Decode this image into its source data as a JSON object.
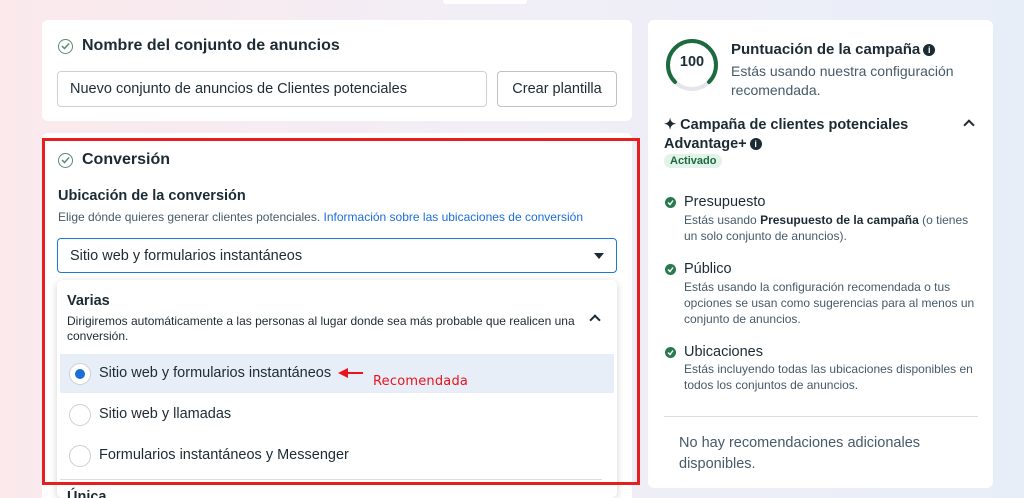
{
  "ad_set_name": {
    "heading": "Nombre del conjunto de anuncios",
    "value": "Nuevo conjunto de anuncios de Clientes potenciales",
    "template_button": "Crear plantilla"
  },
  "conversion": {
    "heading": "Conversión",
    "location_label": "Ubicación de la conversión",
    "helper": "Elige dónde quieres generar clientes potenciales. ",
    "helper_link": "Información sobre las ubicaciones de conversión",
    "selected": "Sitio web y formularios instantáneos",
    "dropdown": {
      "group_title": "Varias",
      "group_desc": "Dirigiremos automáticamente a las personas al lugar donde sea más probable que realicen una conversión.",
      "options": [
        {
          "label": "Sitio web y formularios instantáneos",
          "selected": true
        },
        {
          "label": "Sitio web y llamadas",
          "selected": false
        },
        {
          "label": "Formularios instantáneos y Messenger",
          "selected": false
        }
      ],
      "next_group_title": "Única"
    },
    "annotation": "Recomendada",
    "annotation_color": "#e8141c"
  },
  "sidebar": {
    "score": "100",
    "score_title": "Puntuación de la campaña",
    "score_desc": "Estás usando nuestra configuración recomendada.",
    "advantage_title": "✦ Campaña de clientes potenciales Advantage+",
    "badge": "Activado",
    "items": [
      {
        "title": "Presupuesto",
        "desc_pre": "Estás usando ",
        "desc_bold": "Presupuesto de la campaña",
        "desc_post": " (o tienes un solo conjunto de anuncios)."
      },
      {
        "title": "Público",
        "desc": "Estás usando la configuración recomendada o tus opciones se usan como sugerencias para al menos un conjunto de anuncios."
      },
      {
        "title": "Ubicaciones",
        "desc": "Estás incluyendo todas las ubicaciones disponibles en todos los conjuntos de anuncios."
      }
    ],
    "no_recommendations": "No hay recomendaciones adicionales disponibles."
  }
}
